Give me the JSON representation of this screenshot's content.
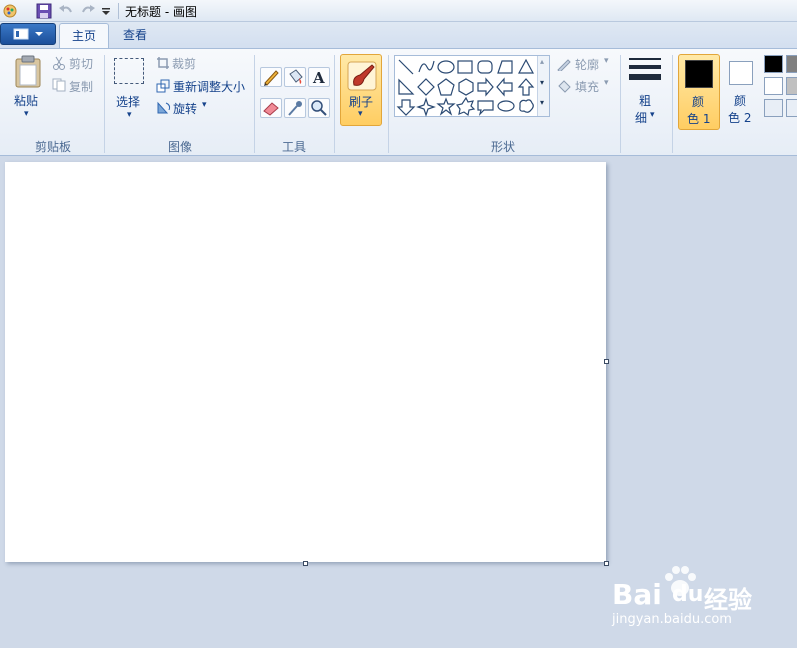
{
  "window": {
    "title": "无标题 - 画图"
  },
  "tabs": [
    {
      "label": "主页"
    },
    {
      "label": "查看"
    }
  ],
  "clipboard": {
    "paste_label": "粘贴",
    "cut_label": "剪切",
    "copy_label": "复制",
    "group_label": "剪贴板"
  },
  "image": {
    "select_label": "选择",
    "crop_label": "裁剪",
    "resize_label": "重新调整大小",
    "rotate_label": "旋转",
    "group_label": "图像"
  },
  "tools": {
    "group_label": "工具"
  },
  "brushes": {
    "label": "刷子"
  },
  "shapes": {
    "outline_label": "轮廓",
    "fill_label": "填充",
    "group_label": "形状"
  },
  "size": {
    "label_line1": "粗",
    "label_line2": "细"
  },
  "colors": {
    "color1_line1": "颜",
    "color1_line2": "色 1",
    "color2_line1": "颜",
    "color2_line2": "色 2",
    "color1_value": "#000000",
    "color2_value": "#ffffff",
    "palette": [
      "#000000",
      "#808080",
      "#ffffff",
      "#c0c0c0"
    ]
  },
  "watermark": {
    "brand": "Bai",
    "brand2": "du",
    "brand_cn": "经验",
    "url": "jingyan.baidu.com"
  }
}
